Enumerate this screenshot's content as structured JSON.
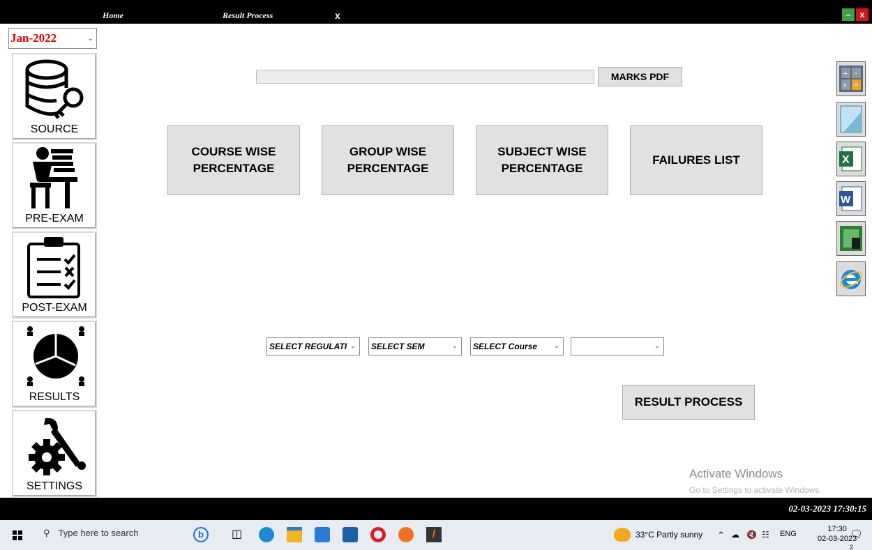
{
  "tabs": {
    "home": "Home",
    "result_process": "Result Process",
    "close": "x"
  },
  "window": {
    "minimize": "–",
    "close": "x"
  },
  "sidebar": {
    "month": "Jan-2022",
    "items": [
      {
        "label": "SOURCE",
        "icon": "database-key-icon"
      },
      {
        "label": "PRE-EXAM",
        "icon": "student-desk-icon"
      },
      {
        "label": "POST-EXAM",
        "icon": "clipboard-checklist-icon"
      },
      {
        "label": "RESULTS",
        "icon": "pie-chart-people-icon"
      },
      {
        "label": "SETTINGS",
        "icon": "gear-wrench-icon"
      }
    ]
  },
  "main": {
    "path_value": "",
    "marks_pdf": "MARKS PDF",
    "course_wise": "COURSE WISE PERCENTAGE",
    "group_wise": "GROUP WISE PERCENTAGE",
    "subject_wise": "SUBJECT WISE PERCENTAGE",
    "failures": "FAILURES LIST",
    "regulation": "SELECT REGULATIC",
    "sem": "SELECT SEM",
    "course": "SELECT Course",
    "extra": "",
    "result_process": "RESULT PROCESS"
  },
  "tools": [
    "calculator-icon",
    "notepad-icon",
    "excel-icon",
    "word-icon",
    "snipping-icon",
    "internet-explorer-icon"
  ],
  "watermark": {
    "title": "Activate Windows",
    "subtitle": "Go to Settings to activate Windows."
  },
  "status": {
    "datetime": "02-03-2023 17:30:15"
  },
  "taskbar": {
    "search": "Type here to search",
    "weather": "33°C  Partly sunny",
    "lang": "ENG",
    "time": "17:30",
    "date": "02-03-2023",
    "notification_count": "2"
  },
  "colors": {
    "month_text": "#e00000",
    "button_bg": "#e1e1e1",
    "excel": "#1f7244",
    "word": "#2b579a"
  }
}
